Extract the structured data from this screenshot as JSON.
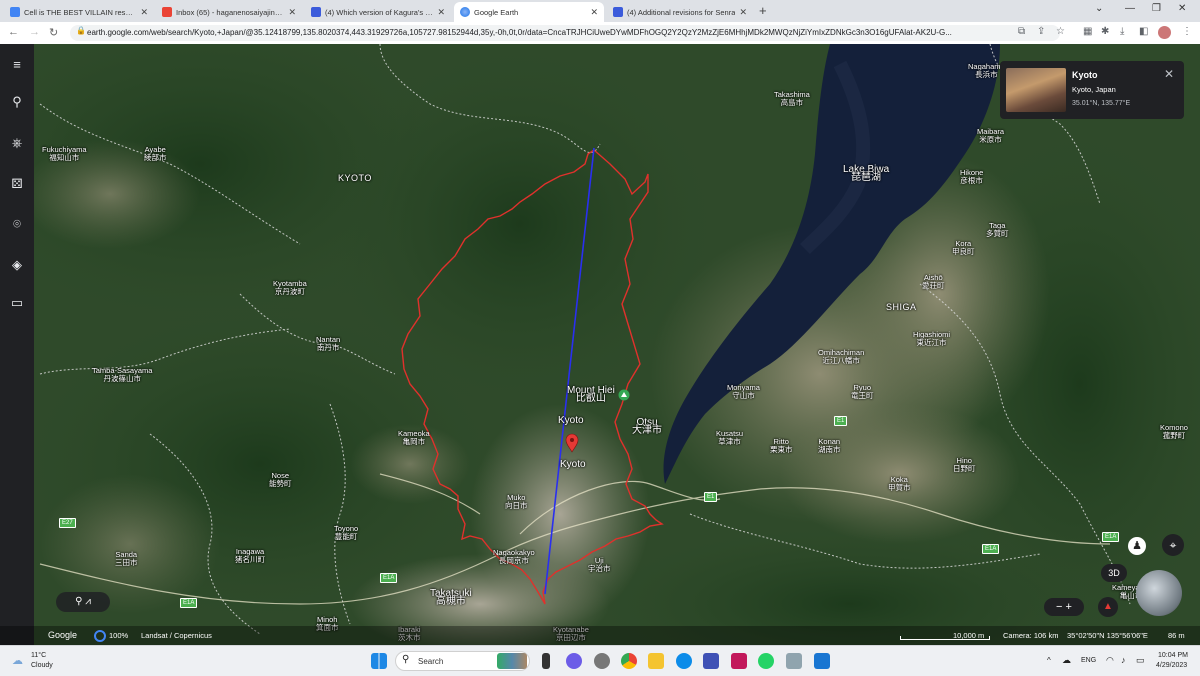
{
  "browser": {
    "tabs": [
      {
        "title": "Cell is THE BEST VILLAIN respons",
        "active": false
      },
      {
        "title": "Inbox (65) - haganenosaiyajin@g",
        "active": false
      },
      {
        "title": "(4) Which version of Kagura's fea",
        "active": false
      },
      {
        "title": "Google Earth",
        "active": true
      },
      {
        "title": "(4) Additional revisions for Senra",
        "active": false
      }
    ],
    "url": "earth.google.com/web/search/Kyoto,+Japan/@35.12418799,135.8020374,443.31929726a,105727.98152944d,35y,-0h,0t,0r/data=CncaTRJHCiUweDYwMDFhOGQ2Y2QzY2MzZjE6MHhjMDk2MWQzNjZiYmIxZDNkGc3n3O16gUFAlat-AK2U-G..."
  },
  "info_card": {
    "title": "Kyoto",
    "subtitle": "Kyoto, Japan",
    "coords": "35.01°N, 135.77°E"
  },
  "map_labels": {
    "fukuchiyama": "Fukuchiyama\n福知山市",
    "ayabe": "Ayabe\n綾部市",
    "kyoto_pref": "KYOTO",
    "kyotamba": "Kyotamba\n京丹波町",
    "nantan": "Nantan\n南丹市",
    "tamba_sasayama": "Tamba-Sasayama\n丹波篠山市",
    "kameoka": "Kameoka\n亀岡市",
    "nose": "Nose\n能勢町",
    "toyono": "Toyono\n豊能町",
    "sanda": "Sanda\n三田市",
    "inagawa": "Inagawa\n猪名川町",
    "minoh": "Minoh\n箕面市",
    "takatsuki": "Takatsuki\n高槻市",
    "ibaraki": "Ibaraki\n茨木市",
    "kyotanabe": "Kyotanabe\n京田辺市",
    "muko": "Muko\n向日市",
    "nagaokakyo": "Nagaokakyo\n長岡京市",
    "uji": "Uji\n宇治市",
    "mount_hiei": "Mount Hiei\n比叡山",
    "kyoto_city": "Kyoto",
    "kyoto_pin": "Kyoto",
    "otsu": "Otsu\n大津市",
    "kusatsu": "Kusatsu\n草津市",
    "ritto": "Ritto\n栗東市",
    "konan": "Konan\n湖南市",
    "moriyama": "Moriyama\n守山市",
    "ryuo": "Ryuo\n竜王町",
    "omihachiman": "Omihachiman\n近江八幡市",
    "higashiomi": "Higashiomi\n東近江市",
    "aisho": "Aishō\n愛荘町",
    "kora": "Kora\n甲良町",
    "taga": "Taga\n多賀町",
    "hikone": "Hikone\n彦根市",
    "maibara": "Maibara\n米原市",
    "nagahama": "Nagahama\n長浜市",
    "takashima": "Takashima\n高島市",
    "lake_biwa": "Lake Biwa\n琵琶湖",
    "shiga": "SHIGA",
    "koka": "Koka\n甲賀市",
    "hino": "Hino\n日野町",
    "komono": "Komono\n菰野町",
    "kameyama": "Kameyama\n亀山市"
  },
  "route_labels": [
    "E27",
    "E1A",
    "E1A",
    "E1",
    "E1",
    "E1A",
    "E1A"
  ],
  "map_bar": {
    "brand": "Google",
    "percent": "100%",
    "attribution": "Landsat / Copernicus",
    "scale": "10,000 m",
    "camera": "Camera: 106 km",
    "coords": "35°02'50\"N 135°56'06\"E",
    "elevation": "86 m"
  },
  "controls": {
    "view_mode": "3D"
  },
  "taskbar": {
    "weather_temp": "11°C",
    "weather_text": "Cloudy",
    "search_placeholder": "Search",
    "language": "ENG",
    "time": "10:04 PM",
    "date": "4/29/2023"
  },
  "colors": {
    "boundary": "#e0312c",
    "measure_line": "#2a2ff0",
    "pin": "#e53935",
    "route_badge": "#4caf50"
  }
}
